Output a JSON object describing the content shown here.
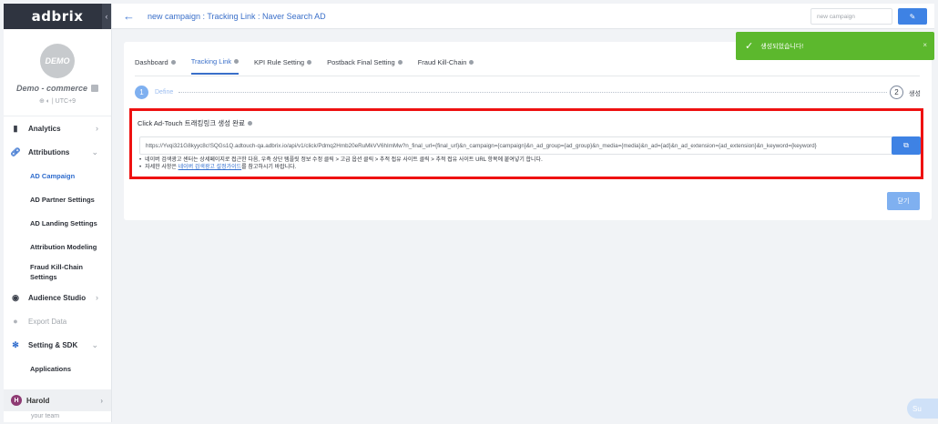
{
  "sidebar": {
    "logo": "adbrix",
    "collapse_icon": "‹",
    "avatar_text": "DEMO",
    "company": "Demo - commerce",
    "platform_info": "⊕ ◐ | UTC+9",
    "nav": {
      "analytics": "Analytics",
      "attributions": "Attributions",
      "ad_campaign": "AD Campaign",
      "ad_partner": "AD Partner Settings",
      "ad_landing": "AD Landing Settings",
      "attribution_modeling": "Attribution Modeling",
      "fraud_kill_chain_1": "Fraud Kill-Chain",
      "fraud_kill_chain_2": "Settings",
      "audience_studio": "Audience Studio",
      "export_data": "Export Data",
      "setting_sdk": "Setting & SDK",
      "applications": "Applications"
    },
    "user_initial": "H",
    "user_name": "Harold",
    "team": "your team"
  },
  "header": {
    "back_icon": "←",
    "title": "new campaign : Tracking Link : Naver Search AD",
    "campaign_placeholder": "new campaign",
    "edit_icon": "✎"
  },
  "tabs": [
    {
      "label": "Dashboard"
    },
    {
      "label": "Tracking Link"
    },
    {
      "label": "KPI Rule Setting"
    },
    {
      "label": "Postback Final Setting"
    },
    {
      "label": "Fraud Kill-Chain"
    }
  ],
  "steps": {
    "step1_num": "1",
    "step1_label": "Define",
    "step2_num": "2",
    "step2_label": "생성"
  },
  "panel": {
    "title": "Click Ad-Touch 트래킹링크 생성 완료",
    "url": "https://Yvqi321G8kyyc8c!SQGs1Q.adtouch-qa.adbrix.io/api/v1/click/Pdmq2Hmb20eRuMkVV6hImMw?n_final_url={final_url}&n_campaign={campaign}&n_ad_group={ad_group}&n_media={media}&n_ad={ad}&n_ad_extension={ad_extension}&n_keyword={keyword}",
    "copy_icon": "⧉",
    "note1": "네이버 검색광고 센터는 상세페이지로 접근한 다음, 우측 상단 템플릿 정보 수정 클릭 > 고급 옵션 클릭 > 추적 접유 사이트 클릭 > 추적 접유 사이트 URL 항목에 붙여넣기 합니다.",
    "note2_pre": "자세한 사항은",
    "note2_link": "네이버 검색광고 설정가이드",
    "note2_post": "를 참고하시기 바랍니다."
  },
  "close_button": "닫기",
  "toast": {
    "check_icon": "✓",
    "message": "생성되었습니다!",
    "close_icon": "×"
  },
  "support": "Su"
}
